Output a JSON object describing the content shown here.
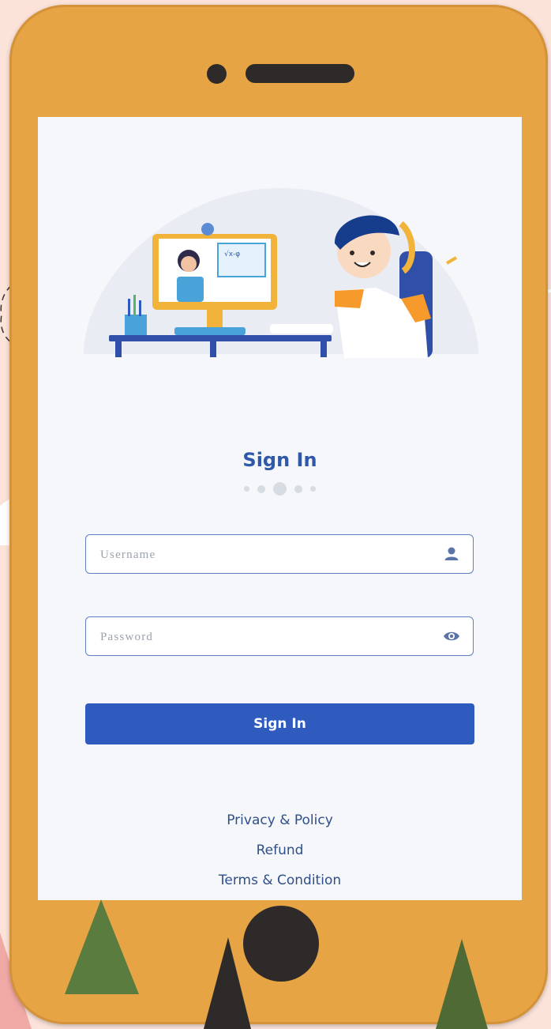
{
  "screen": {
    "title": "Sign In",
    "username": {
      "placeholder": "Username",
      "value": "",
      "icon": "user-icon"
    },
    "password": {
      "placeholder": "Password",
      "value": "",
      "icon": "eye-icon"
    },
    "submit_label": "Sign In",
    "links": {
      "privacy": "Privacy & Policy",
      "refund": "Refund",
      "terms": "Terms & Condition"
    },
    "page_indicator": {
      "count": 5,
      "active_index": 2
    }
  },
  "colors": {
    "accent": "#2f5bbf",
    "title": "#2f58a8",
    "phone_body": "#e6a444",
    "background": "#fbe3da",
    "screen_background": "#f5f7fa"
  }
}
